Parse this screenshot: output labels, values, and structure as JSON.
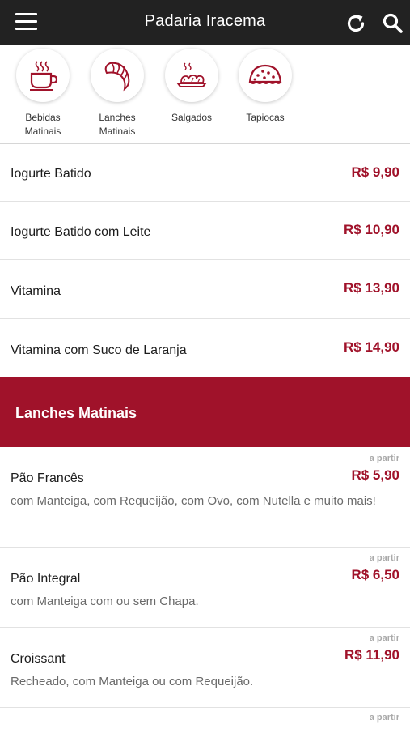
{
  "header": {
    "title": "Padaria Iracema"
  },
  "categories": [
    {
      "label_line1": "Bebidas",
      "label_line2": "Matinais",
      "icon": "coffee-cup-icon"
    },
    {
      "label_line1": "Lanches",
      "label_line2": "Matinais",
      "icon": "croissant-icon"
    },
    {
      "label_line1": "Salgados",
      "label_line2": "",
      "icon": "pastries-tray-icon"
    },
    {
      "label_line1": "Tapiocas",
      "label_line2": "",
      "icon": "tapioca-icon"
    }
  ],
  "drinks": [
    {
      "name": "Iogurte Batido",
      "price": "R$ 9,90"
    },
    {
      "name": "Iogurte Batido com Leite",
      "price": "R$ 10,90"
    },
    {
      "name": "Vitamina",
      "price": "R$ 13,90"
    },
    {
      "name": "Vitamina com Suco de Laranja",
      "price": "R$ 14,90"
    }
  ],
  "section": {
    "title": "Lanches Matinais"
  },
  "snacks": [
    {
      "from": "a partir",
      "name": "Pão Francês",
      "price": "R$ 5,90",
      "desc": "com Manteiga, com Requeijão, com Ovo, com Nutella e muito mais!"
    },
    {
      "from": "a partir",
      "name": "Pão Integral",
      "price": "R$ 6,50",
      "desc": "com Manteiga com ou sem Chapa."
    },
    {
      "from": "a partir",
      "name": "Croissant",
      "price": "R$ 11,90",
      "desc": "Recheado, com Manteiga ou com Requeijão."
    },
    {
      "from": "a partir"
    }
  ],
  "colors": {
    "accent": "#a0122a",
    "topbar": "#222222"
  }
}
